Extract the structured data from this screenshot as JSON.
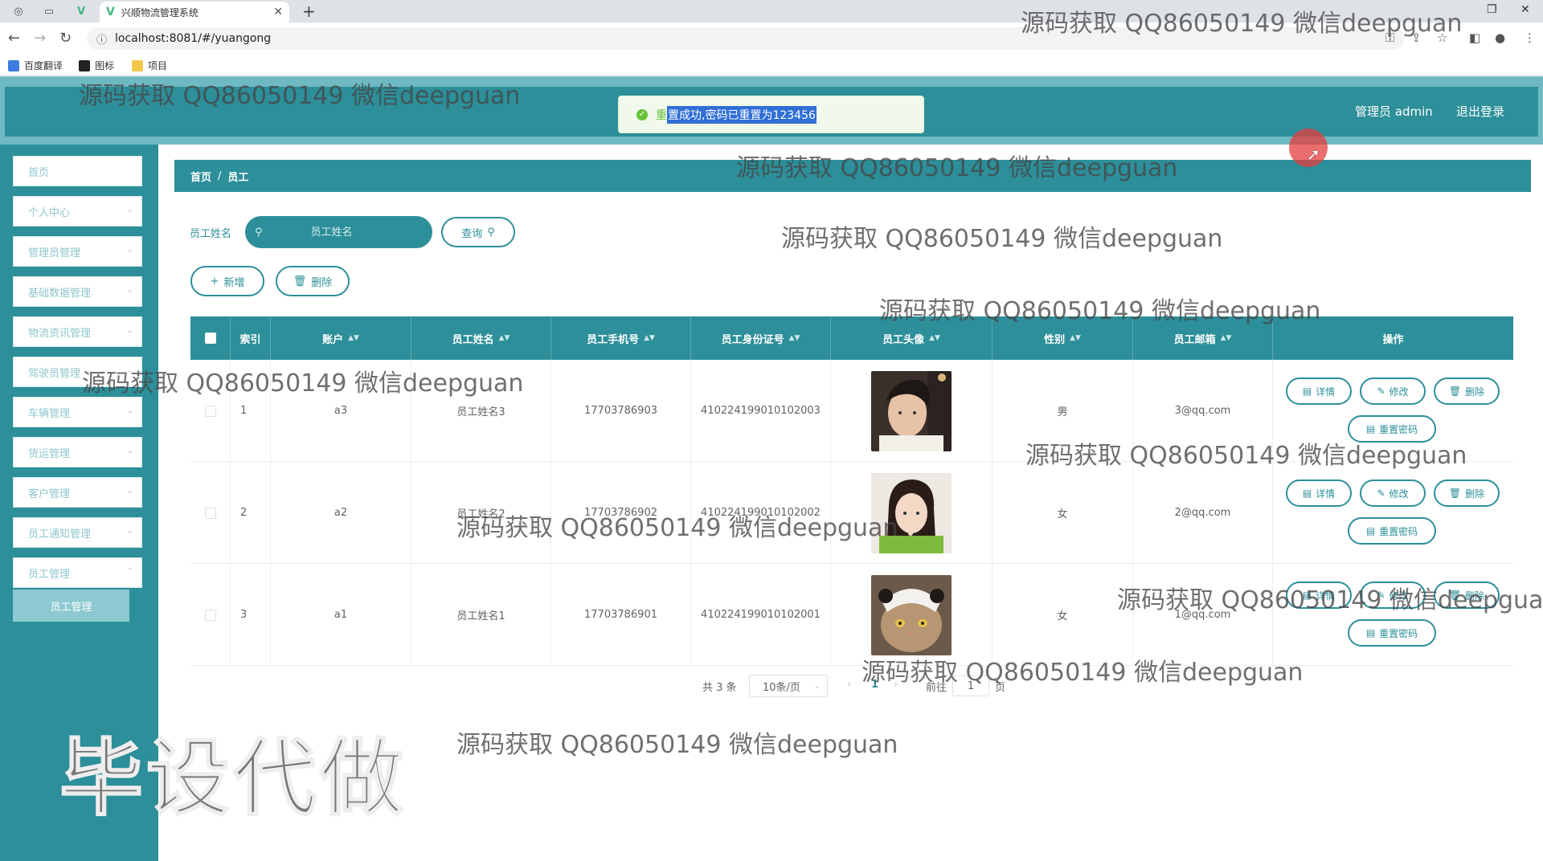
{
  "browser": {
    "tab_title": "兴顺物流管理系统",
    "url": "localhost:8081/#/yuangong",
    "bookmarks": [
      "百度翻译",
      "图标",
      "项目"
    ]
  },
  "header": {
    "user_label": "管理员 admin",
    "logout_label": "退出登录"
  },
  "toast": {
    "prefix": "重",
    "selected_text": "置成功,密码已重置为123456"
  },
  "sidebar": {
    "items": [
      {
        "label": "首页"
      },
      {
        "label": "个人中心"
      },
      {
        "label": "管理员管理"
      },
      {
        "label": "基础数据管理"
      },
      {
        "label": "物流资讯管理"
      },
      {
        "label": "驾驶员管理"
      },
      {
        "label": "车辆管理"
      },
      {
        "label": "货运管理"
      },
      {
        "label": "客户管理"
      },
      {
        "label": "员工通知管理"
      },
      {
        "label": "员工管理"
      }
    ],
    "active_submenu": "员工管理"
  },
  "breadcrumb": {
    "home": "首页",
    "separator": "/",
    "current": "员工"
  },
  "search": {
    "label": "员工姓名",
    "placeholder": "员工姓名",
    "query_button": "查询"
  },
  "actions": {
    "add_label": "新增",
    "delete_label": "删除"
  },
  "table": {
    "columns": [
      "索引",
      "账户",
      "员工姓名",
      "员工手机号",
      "员工身份证号",
      "员工头像",
      "性别",
      "员工邮箱",
      "操作"
    ],
    "rows": [
      {
        "index": "1",
        "account": "a3",
        "name": "员工姓名3",
        "phone": "17703786903",
        "id_card": "410224199010102003",
        "gender": "男",
        "email": "3@qq.com",
        "avatar": "young-man-photo"
      },
      {
        "index": "2",
        "account": "a2",
        "name": "员工姓名2",
        "phone": "17703786902",
        "id_card": "410224199010102002",
        "gender": "女",
        "email": "2@qq.com",
        "avatar": "young-woman-photo"
      },
      {
        "index": "3",
        "account": "a1",
        "name": "员工姓名1",
        "phone": "17703786901",
        "id_card": "410224199010102001",
        "gender": "女",
        "email": "1@qq.com",
        "avatar": "cat-photo"
      }
    ],
    "row_actions": {
      "detail": "详情",
      "edit": "修改",
      "delete": "删除",
      "reset_password": "重置密码"
    }
  },
  "pagination": {
    "total_text": "共 3 条",
    "page_size": "10条/页",
    "current_page": "1",
    "goto_label": "前往",
    "goto_value": "1",
    "page_suffix": "页"
  },
  "watermarks": {
    "text": "源码获取 QQ86050149 微信deepguan",
    "big_text": "毕设代做"
  },
  "colors": {
    "primary": "#2c8f99",
    "success": "#67c23a"
  }
}
